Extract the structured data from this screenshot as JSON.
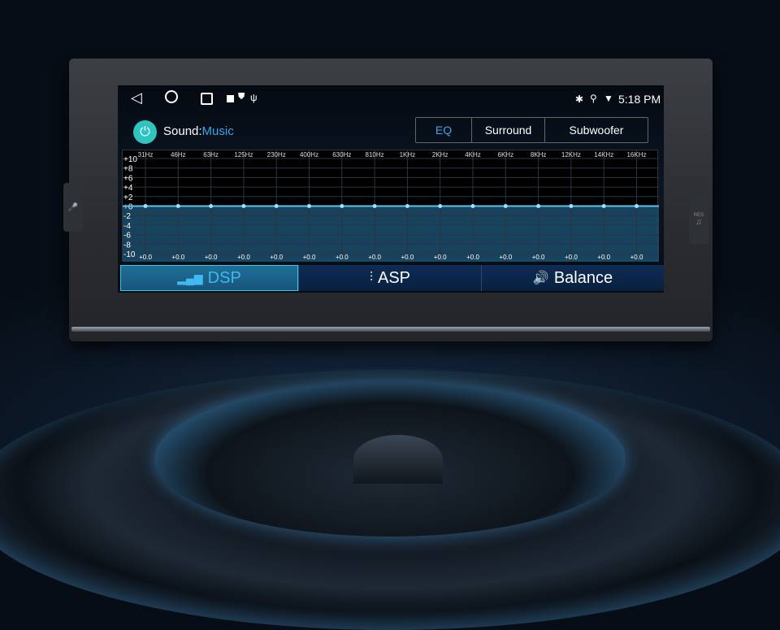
{
  "status": {
    "time": "5:18 PM",
    "left_icons": [
      "back-icon",
      "home-icon",
      "recents-icon",
      "image-icon",
      "shield-icon",
      "usb-icon"
    ],
    "right_icons": [
      "bluetooth-icon",
      "location-icon",
      "wifi-icon"
    ]
  },
  "header": {
    "sound_label": "Sound:",
    "sound_mode": "Music",
    "segments": [
      {
        "label": "EQ",
        "active": true
      },
      {
        "label": "Surround",
        "active": false
      },
      {
        "label": "Subwoofer",
        "active": false
      }
    ]
  },
  "bezel": {
    "res_label": "RES"
  },
  "tabs": [
    {
      "label": "DSP",
      "active": true
    },
    {
      "label": "ASP",
      "active": false
    },
    {
      "label": "Balance",
      "active": false
    }
  ],
  "colors": {
    "accent": "#3aa8e8",
    "power": "#2ec5c0",
    "fill": "#1c4f6f",
    "line": "#5fbfe6"
  },
  "chart_data": {
    "type": "line",
    "title": "EQ",
    "categories": [
      "31Hz",
      "46Hz",
      "63Hz",
      "125Hz",
      "230Hz",
      "400Hz",
      "630Hz",
      "810Hz",
      "1KHz",
      "2KHz",
      "4KHz",
      "6KHz",
      "8KHz",
      "12KHz",
      "14KHz",
      "16KHz"
    ],
    "values": [
      0,
      0,
      0,
      0,
      0,
      0,
      0,
      0,
      0,
      0,
      0,
      0,
      0,
      0,
      0,
      0
    ],
    "value_labels": [
      "+0.0",
      "+0.0",
      "+0.0",
      "+0.0",
      "+0.0",
      "+0.0",
      "+0.0",
      "+0.0",
      "+0.0",
      "+0.0",
      "+0.0",
      "+0.0",
      "+0.0",
      "+0.0",
      "+0.0",
      "+0.0"
    ],
    "yticks": [
      "+10",
      "+8",
      "+6",
      "+4",
      "+2",
      "+0",
      "-2",
      "-4",
      "-6",
      "-8",
      "-10"
    ],
    "ylim": [
      -10,
      10
    ],
    "grid": true
  }
}
